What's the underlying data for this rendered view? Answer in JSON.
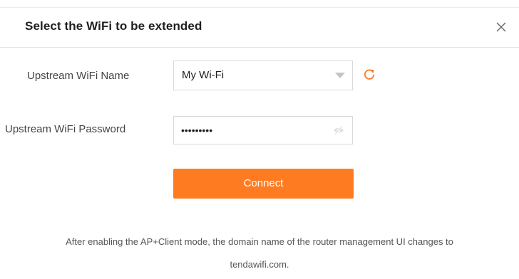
{
  "dialog": {
    "title": "Select the WiFi to be extended",
    "close_icon": "close-icon"
  },
  "form": {
    "name_label": "Upstream WiFi Name",
    "name_value": "My Wi-Fi",
    "caret_icon": "chevron-down-icon",
    "refresh_icon": "refresh-icon",
    "password_label": "Upstream WiFi Password",
    "password_value": "abc123456",
    "eye_icon": "eye-off-icon",
    "connect_label": "Connect"
  },
  "note": {
    "line1": "After enabling the AP+Client mode, the domain name of the router management UI changes to",
    "line2": "tendawifi.com."
  },
  "colors": {
    "accent": "#ff7b22",
    "title": "#1f1f1f",
    "label": "#444444",
    "border": "#d9d9d9"
  }
}
